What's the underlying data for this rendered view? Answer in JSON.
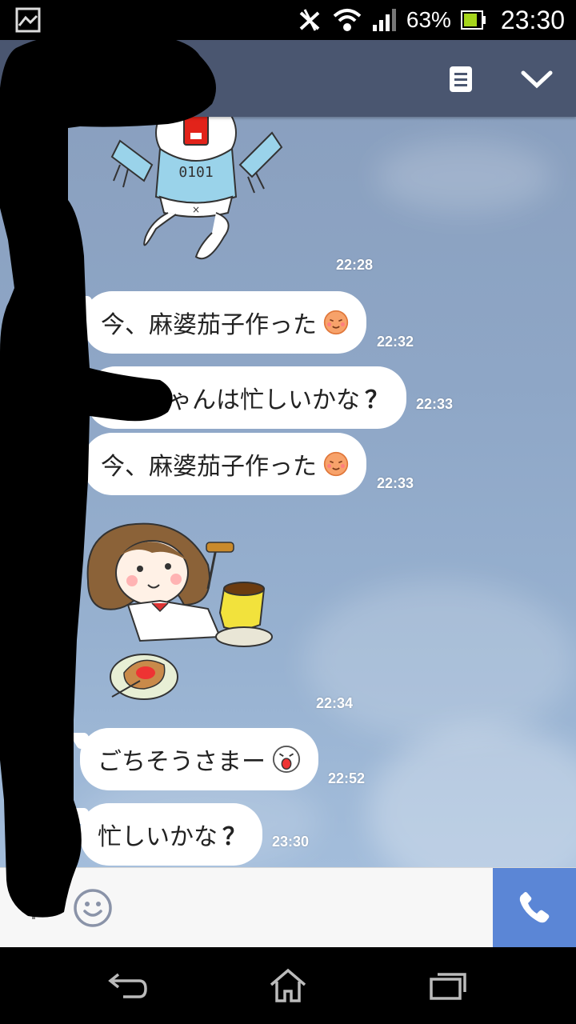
{
  "status_bar": {
    "battery_percent": "63%",
    "time": "23:30",
    "icons": [
      "screenshot-icon",
      "nfc-off-icon",
      "wifi-icon",
      "signal-icon",
      "battery-icon"
    ]
  },
  "header": {
    "icons": [
      "notes-icon",
      "chevron-down-icon"
    ],
    "color": "#4a5670"
  },
  "messages": [
    {
      "type": "sticker",
      "sticker": "binary-shirt-character-sticker",
      "time": "22:28"
    },
    {
      "type": "text",
      "text": "今、麻婆茄子作った",
      "emoji": "yummy-face-emoji",
      "time": "22:32"
    },
    {
      "type": "text",
      "text": "ゃんは忙しいかな",
      "suffix": "？",
      "time": "22:33"
    },
    {
      "type": "text",
      "text": "今、麻婆茄子作った",
      "emoji": "yummy-face-emoji",
      "time": "22:33"
    },
    {
      "type": "sticker",
      "sticker": "girl-eating-toast-coffee-sticker",
      "time": "22:34"
    },
    {
      "type": "text",
      "text": "ごちそうさまー",
      "emoji": "shocked-face-emoji",
      "time": "22:52"
    },
    {
      "type": "text",
      "text": "忙しいかな",
      "suffix": "？",
      "time": "23:30"
    }
  ],
  "input_bar": {
    "icons": [
      "plus-icon",
      "emoji-icon",
      "call-icon"
    ],
    "call_color": "#5b86d6"
  },
  "nav_bar": {
    "icons": [
      "back-icon",
      "home-icon",
      "recent-apps-icon"
    ]
  }
}
